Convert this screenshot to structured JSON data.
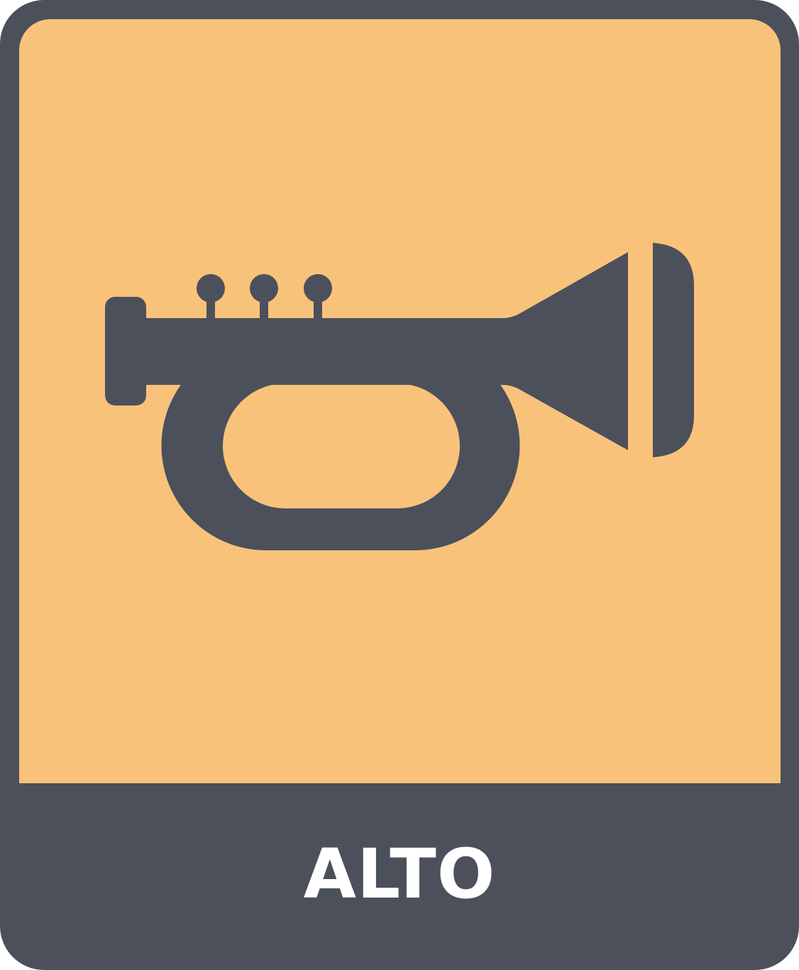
{
  "icon": {
    "name": "trumpet-icon",
    "label": "ALTO"
  },
  "colors": {
    "background": "#f9c27b",
    "foreground": "#4b505b",
    "label_text": "#ffffff"
  }
}
